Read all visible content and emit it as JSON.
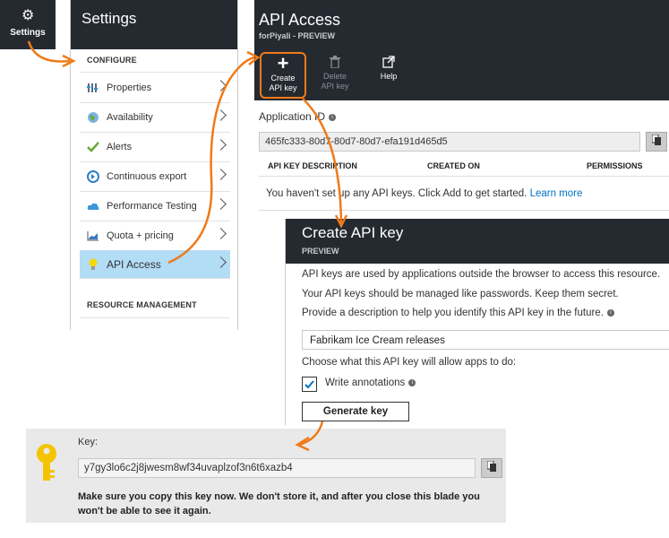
{
  "settings_tile": {
    "label": "Settings",
    "icon": "gear-icon"
  },
  "settings_blade": {
    "title": "Settings",
    "configure_title": "CONFIGURE",
    "items": [
      {
        "label": "Properties",
        "icon": "properties-icon"
      },
      {
        "label": "Availability",
        "icon": "globe-icon"
      },
      {
        "label": "Alerts",
        "icon": "checkmark-icon"
      },
      {
        "label": "Continuous export",
        "icon": "export-icon"
      },
      {
        "label": "Performance Testing",
        "icon": "cloud-icon"
      },
      {
        "label": "Quota + pricing",
        "icon": "chart-icon"
      },
      {
        "label": "API Access",
        "icon": "lightbulb-icon",
        "active": true
      }
    ],
    "resource_title": "RESOURCE MANAGEMENT"
  },
  "api_blade": {
    "title": "API Access",
    "subtitle": "forPiyali - PREVIEW",
    "toolbar": {
      "create_label": "Create API key",
      "delete_label": "Delete API key",
      "help_label": "Help"
    },
    "application_id_label": "Application ID",
    "application_id_value": "465fc333-80d7-80d7-80d7-efa191d465d5",
    "table_headers": [
      "API KEY DESCRIPTION",
      "CREATED ON",
      "PERMISSIONS"
    ],
    "empty_message": "You haven't set up any API keys. Click Add to get started.",
    "learn_more": "Learn more"
  },
  "create_blade": {
    "title": "Create API key",
    "subtitle": "PREVIEW",
    "line1": "API keys are used by applications outside the browser to access this resource.",
    "line2": "Your API keys should be managed like passwords. Keep them secret.",
    "line3": "Provide a description to help you identify this API key in the future.",
    "description_value": "Fabrikam Ice Cream releases",
    "permissions_prompt": "Choose what this API key will allow apps to do:",
    "write_annotations_label": "Write annotations",
    "write_annotations_checked": true,
    "generate_button": "Generate key"
  },
  "key_panel": {
    "key_label": "Key:",
    "key_value": "y7gy3lo6c2j8jwesm8wf34uvaplzof3n6t6xazb4",
    "warning": "Make sure you copy this key now. We don't store it, and after you close this blade you won't be able to see it again."
  },
  "colors": {
    "accent_orange": "#f07a1a",
    "dark_header": "#252a31",
    "link_blue": "#0072c6",
    "active_item": "#b3dcf5"
  }
}
